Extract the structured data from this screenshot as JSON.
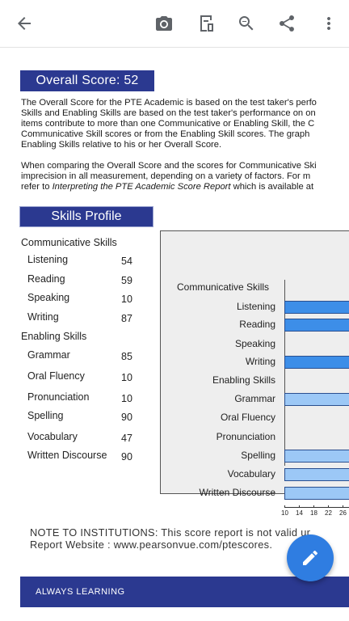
{
  "toolbar": {
    "icons": [
      "back-arrow-icon",
      "camera-icon",
      "document-icon",
      "zoom-out-icon",
      "share-icon",
      "more-vert-icon"
    ]
  },
  "overall": {
    "label": "Overall Score:",
    "value": "52"
  },
  "intro_lines": [
    "The Overall Score for the PTE Academic is based on the test taker's perfo",
    "Skills and Enabling Skills are based on the test taker's performance on on",
    "items contribute to more than one Communicative or Enabling Skill, the C",
    "Communicative Skill scores or from the Enabling Skill scores.  The graph",
    "Enabling Skills relative to his or her Overall Score."
  ],
  "comparison_lines": [
    "When comparing the Overall Score and the scores for Communicative Ski",
    "imprecision in all measurement, depending on a variety of factors.  For m"
  ],
  "comparison_last": {
    "prefix": "refer to ",
    "italic": "Interpreting the PTE Academic Score Report",
    "suffix": " which is available at"
  },
  "skills_profile": {
    "title": "Skills Profile",
    "communicative_heading": "Communicative Skills",
    "communicative": [
      {
        "name": "Listening",
        "score": "54"
      },
      {
        "name": "Reading",
        "score": "59"
      },
      {
        "name": "Speaking",
        "score": "10"
      },
      {
        "name": "Writing",
        "score": "87"
      }
    ],
    "enabling_heading": "Enabling Skills",
    "enabling": [
      {
        "name": "Grammar",
        "score": "85"
      },
      {
        "name": "Oral Fluency",
        "score": "10"
      },
      {
        "name": "Pronunciation",
        "score": "10"
      },
      {
        "name": "Spelling",
        "score": "90"
      },
      {
        "name": "Vocabulary",
        "score": "47"
      },
      {
        "name": "Written Discourse",
        "score": "90"
      }
    ]
  },
  "chart_data": {
    "type": "bar",
    "orientation": "horizontal",
    "categories": [
      "Communicative Skills",
      "Listening",
      "Reading",
      "Speaking",
      "Writing",
      "Enabling Skills",
      "Grammar",
      "Oral Fluency",
      "Pronunciation",
      "Spelling",
      "Vocabulary",
      "Written Discourse"
    ],
    "values": [
      null,
      54,
      59,
      10,
      87,
      null,
      85,
      10,
      10,
      90,
      47,
      90
    ],
    "groups": [
      "heading",
      "communicative",
      "communicative",
      "communicative",
      "communicative",
      "heading",
      "enabling",
      "enabling",
      "enabling",
      "enabling",
      "enabling",
      "enabling"
    ],
    "x_ticks": [
      "10",
      "14",
      "18",
      "22",
      "26"
    ],
    "xlim": [
      10,
      90
    ],
    "colors": {
      "communicative": "#3d8ee8",
      "enabling": "#9cc8f6",
      "border": "#2a4f8f"
    }
  },
  "note": {
    "line1": "NOTE TO INSTITUTIONS:  This score report is not valid ur",
    "line2": "Report Website :  www.pearsonvue.com/ptescores."
  },
  "footer": {
    "text": "ALWAYS LEARNING"
  },
  "fab": {
    "icon": "edit-pencil-icon"
  }
}
